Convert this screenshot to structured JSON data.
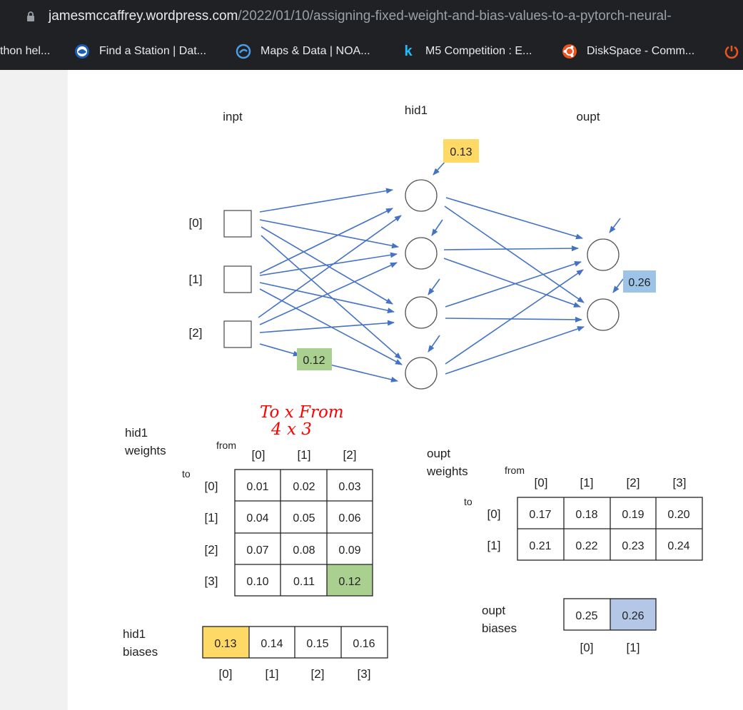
{
  "browser": {
    "url_domain": "jamesmccaffrey.wordpress.com",
    "url_path": "/2022/01/10/assigning-fixed-weight-and-bias-values-to-a-pytorch-neural-",
    "bookmarks": [
      {
        "label": "thon hel...",
        "icon": "python-icon"
      },
      {
        "label": "Find a Station | Dat...",
        "icon": "noaa-icon"
      },
      {
        "label": "Maps & Data | NOA...",
        "icon": "climate-icon"
      },
      {
        "label": "M5 Competition : E...",
        "icon": "kaggle-icon"
      },
      {
        "label": "DiskSpace - Comm...",
        "icon": "ubuntu-icon"
      }
    ]
  },
  "diagram": {
    "labels": {
      "inpt": "inpt",
      "hid1": "hid1",
      "ouput": "oupt"
    },
    "input_labels": [
      "[0]",
      "[1]",
      "[2]"
    ],
    "callouts": {
      "hid_bias": "0.13",
      "weight": "0.12",
      "out_bias": "0.26"
    },
    "annotation_line1": "To x From",
    "annotation_line2": "4 x 3",
    "hid1_weights": {
      "title_line1": "hid1",
      "title_line2": "weights",
      "from": "from",
      "to": "to",
      "cols": [
        "[0]",
        "[1]",
        "[2]"
      ],
      "rows": [
        "[0]",
        "[1]",
        "[2]",
        "[3]"
      ],
      "values": [
        [
          "0.01",
          "0.02",
          "0.03"
        ],
        [
          "0.04",
          "0.05",
          "0.06"
        ],
        [
          "0.07",
          "0.08",
          "0.09"
        ],
        [
          "0.10",
          "0.11",
          "0.12"
        ]
      ]
    },
    "hid1_biases": {
      "title_line1": "hid1",
      "title_line2": "biases",
      "values": [
        "0.13",
        "0.14",
        "0.15",
        "0.16"
      ],
      "index": [
        "[0]",
        "[1]",
        "[2]",
        "[3]"
      ]
    },
    "oupt_weights": {
      "title_line1": "oupt",
      "title_line2": "weights",
      "from": "from",
      "to": "to",
      "cols": [
        "[0]",
        "[1]",
        "[2]",
        "[3]"
      ],
      "rows": [
        "[0]",
        "[1]"
      ],
      "values": [
        [
          "0.17",
          "0.18",
          "0.19",
          "0.20"
        ],
        [
          "0.21",
          "0.22",
          "0.23",
          "0.24"
        ]
      ]
    },
    "oupt_biases": {
      "title_line1": "oupt",
      "title_line2": "biases",
      "values": [
        "0.25",
        "0.26"
      ],
      "index": [
        "[0]",
        "[1]"
      ]
    },
    "colors": {
      "yellow": "#ffd966",
      "green": "#a9d08e",
      "blue": "#9dc3e6",
      "arrow": "#4472c4",
      "annotation": "#ff0000"
    }
  }
}
